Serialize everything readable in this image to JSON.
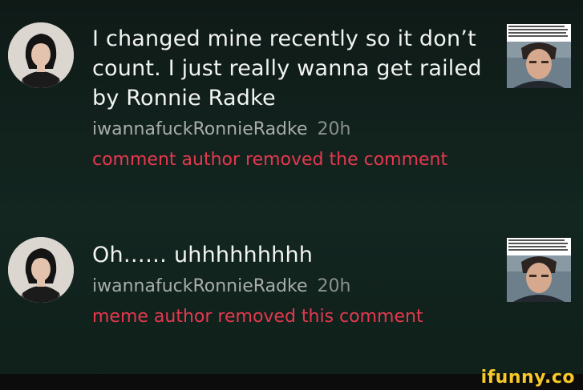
{
  "comments": [
    {
      "text": "I changed mine recently so it don’t count. I just really wanna get railed by Ronnie Radke",
      "username": "iwannafuckRonnieRadke",
      "time": "20h",
      "removed_notice": "comment author removed the comment"
    },
    {
      "text": "Oh…… uhhhhhhhhh",
      "username": "iwannafuckRonnieRadke",
      "time": "20h",
      "removed_notice": "meme author removed this comment"
    }
  ],
  "colors": {
    "background": "#122520",
    "body_text": "#f1f3f1",
    "username": "#a7adaa",
    "removed": "#e6384f",
    "watermark": "#f7c928"
  },
  "watermark": "ifunny.co"
}
